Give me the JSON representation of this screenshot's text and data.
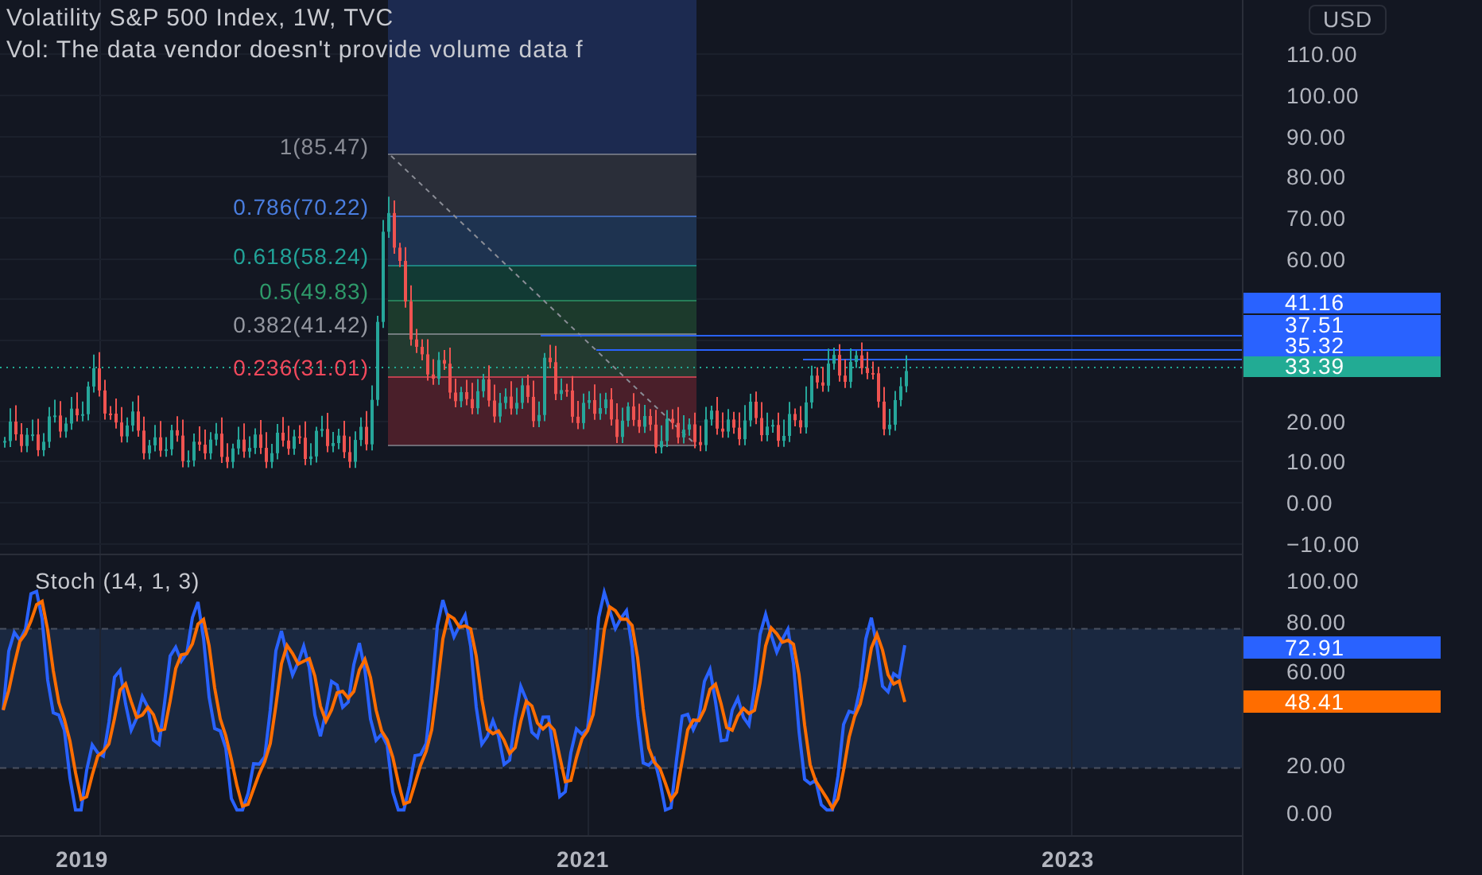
{
  "header": {
    "title": "Volatility S&P 500 Index, 1W, TVC",
    "volume_note": "Vol: The data vendor doesn't provide volume data f"
  },
  "currency_button": "USD",
  "fib_levels": [
    {
      "label": "1(85.47)",
      "color": "#8a8d96"
    },
    {
      "label": "0.786(70.22)",
      "color": "#4a7ee0"
    },
    {
      "label": "0.618(58.24)",
      "color": "#22a398"
    },
    {
      "label": "0.5(49.83)",
      "color": "#2e9a6a"
    },
    {
      "label": "0.382(41.42)",
      "color": "#9598a1"
    },
    {
      "label": "0.236(31.01)",
      "color": "#f2495c"
    }
  ],
  "price_axis": {
    "ticks": [
      "110.00",
      "100.00",
      "90.00",
      "80.00",
      "70.00",
      "60.00",
      "20.00",
      "10.00",
      "0.00",
      "−10.00"
    ],
    "badges": [
      {
        "label": "41.16",
        "color": "#2962ff"
      },
      {
        "label": "37.51",
        "color": "#2962ff"
      },
      {
        "label": "35.32",
        "color": "#2962ff"
      },
      {
        "label": "33.39",
        "color": "#22ab94"
      }
    ]
  },
  "stoch": {
    "title": "Stoch (14, 1, 3)",
    "ticks": [
      "100.00",
      "80.00",
      "60.00",
      "20.00",
      "0.00"
    ],
    "badges": [
      {
        "label": "72.91",
        "color": "#2962ff"
      },
      {
        "label": "48.41",
        "color": "#ff6d00"
      }
    ]
  },
  "time_axis": [
    "2019",
    "2021",
    "2023"
  ]
}
